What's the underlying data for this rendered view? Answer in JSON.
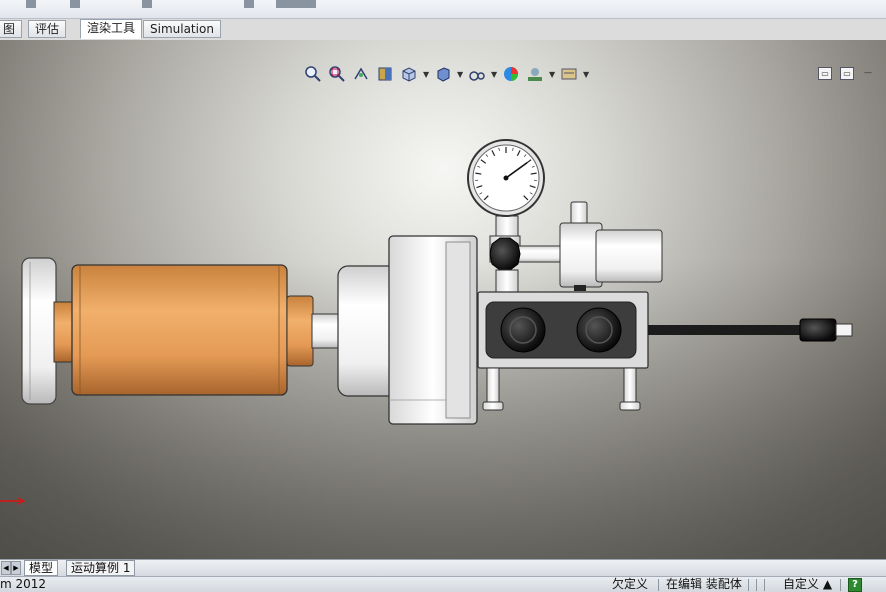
{
  "tabs": [
    {
      "label": "图"
    },
    {
      "label": "评估"
    },
    {
      "label": "渲染工具"
    },
    {
      "label": "Simulation"
    }
  ],
  "hud_icons": [
    "zoom-to-fit-icon",
    "zoom-area-icon",
    "previous-view-icon",
    "section-view-icon",
    "view-orientation-icon",
    "display-style-icon",
    "hide-show-items-icon",
    "edit-appearance-icon",
    "apply-scene-icon",
    "view-settings-icon"
  ],
  "bottom_tabs": [
    {
      "label": "模型"
    },
    {
      "label": "运动算例 1"
    }
  ],
  "status": {
    "app": "m 2012",
    "definition": "欠定义",
    "editing": "在编辑 装配体",
    "units": "自定义 ▲",
    "help": "?"
  },
  "gauge": {
    "min": 0,
    "max": 10,
    "needle": 7
  },
  "colors": {
    "cylinder": "#e8a05a",
    "viewport_center": "#f6f6f4",
    "axis_x": "#d11"
  }
}
